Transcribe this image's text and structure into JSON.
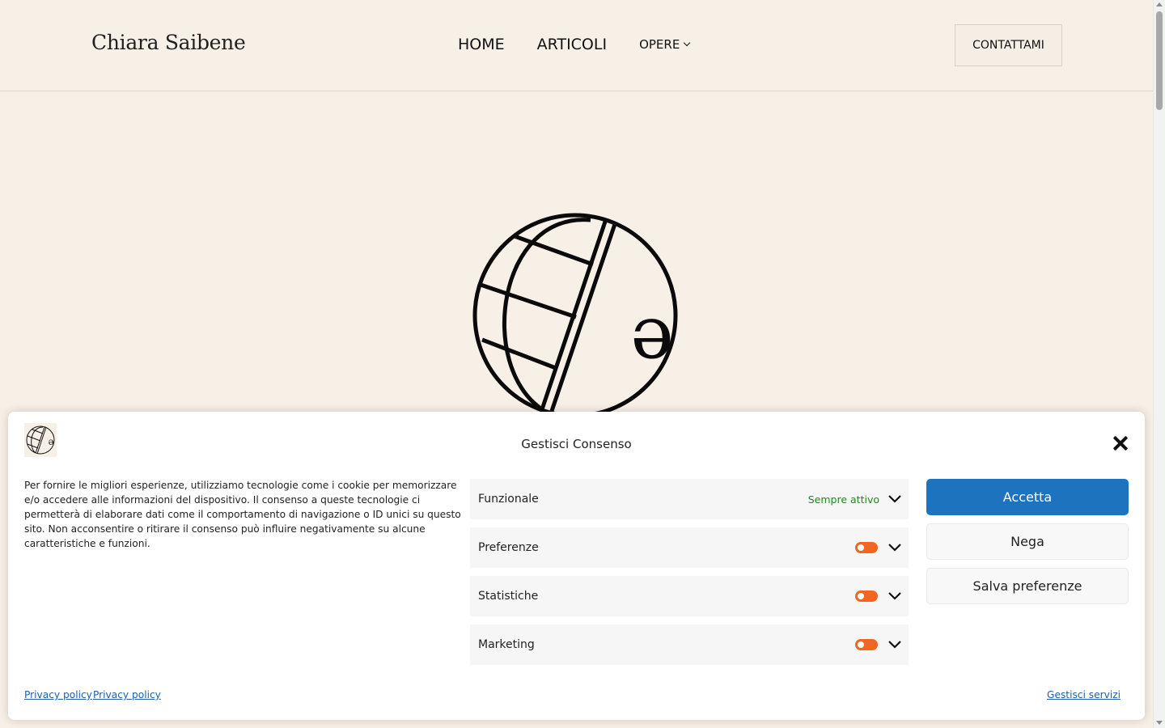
{
  "header": {
    "site_title": "Chiara Saibene",
    "nav": {
      "home": "HOME",
      "articoli": "ARTICOLI",
      "opere": "OPERE"
    },
    "contact_label": "CONTATTAMI"
  },
  "hero": {
    "logo_glyph": "ə"
  },
  "consent": {
    "logo_glyph": "ə",
    "title": "Gestisci Consenso",
    "description": "Per fornire le migliori esperienze, utilizziamo tecnologie come i cookie per memorizzare e/o accedere alle informazioni del dispositivo. Il consenso a queste tecnologie ci permetterà di elaborare dati come il comportamento di navigazione o ID unici su questo sito. Non acconsentire o ritirare il consenso può influire negativamente su alcune caratteristiche e funzioni.",
    "categories": [
      {
        "label": "Funzionale",
        "status": "Sempre attivo"
      },
      {
        "label": "Preferenze"
      },
      {
        "label": "Statistiche"
      },
      {
        "label": "Marketing"
      }
    ],
    "buttons": {
      "accept": "Accetta",
      "deny": "Nega",
      "save": "Salva preferenze"
    },
    "links": {
      "privacy_1": "Privacy policy",
      "privacy_2": "Privacy policy",
      "manage_services": "Gestisci servizi"
    },
    "colors": {
      "accept_bg": "#1e73be",
      "toggle": "#f26522",
      "always_active": "#1e8a1e"
    }
  }
}
